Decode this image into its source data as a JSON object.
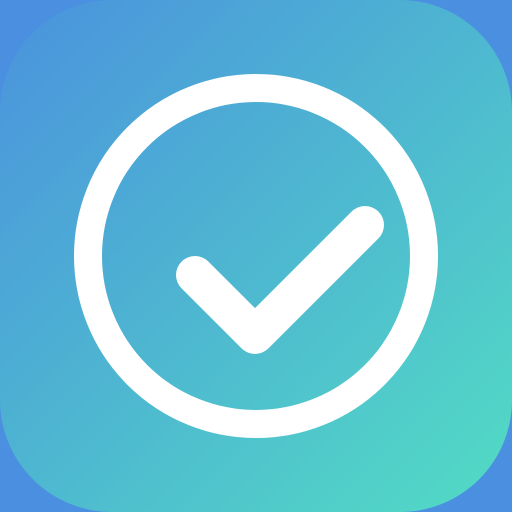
{
  "icon": {
    "name": "checkmark-circle-icon",
    "background_color": "#4a8fe0",
    "gradient_start": "#4a92dd",
    "gradient_end": "#52dcc4",
    "glyph_color": "#ffffff"
  }
}
